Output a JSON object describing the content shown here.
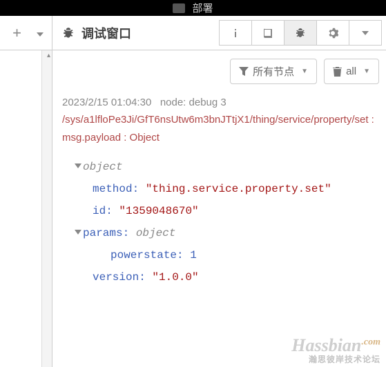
{
  "deploy": {
    "label": "部署"
  },
  "panel": {
    "title": "调试窗口"
  },
  "filter": {
    "nodes_label": "所有节点",
    "trash_label": "all"
  },
  "message": {
    "timestamp": "2023/2/15 01:04:30",
    "node_label": "node: debug 3",
    "topic_line": "/sys/a1lfloPe3Ji/GfT6nsUtw6m3bnJTtjX1/thing/service/property/set : msg.payload : Object"
  },
  "tree": {
    "root_type": "object",
    "method_key": "method:",
    "method_val": "\"thing.service.property.set\"",
    "id_key": "id:",
    "id_val": "\"1359048670\"",
    "params_key": "params:",
    "params_type": "object",
    "powerstate_key": "powerstate:",
    "powerstate_val": "1",
    "version_key": "version:",
    "version_val": "\"1.0.0\""
  },
  "watermark": {
    "main": "Hassbian",
    "dotcom": ".com",
    "sub": "瀚思彼岸技术论坛"
  }
}
